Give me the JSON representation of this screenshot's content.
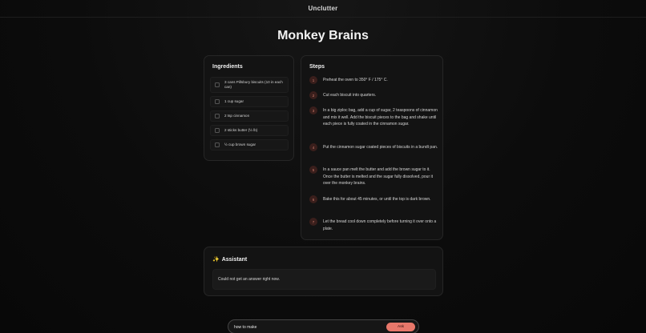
{
  "app": {
    "title": "Unclutter"
  },
  "recipe": {
    "title": "Monkey Brains"
  },
  "ingredients": {
    "title": "Ingredients",
    "items": [
      {
        "label": "3 cans Pillsbury biscuits (10 in each can)",
        "checked": false
      },
      {
        "label": "1 cup sugar",
        "checked": false
      },
      {
        "label": "2 tsp cinnamon",
        "checked": false
      },
      {
        "label": "2 sticks butter (½ lb)",
        "checked": false
      },
      {
        "label": "½ cup brown sugar",
        "checked": false
      }
    ]
  },
  "steps": {
    "title": "Steps",
    "items": [
      {
        "number": "1",
        "text": "Preheat the oven to 350° F / 175° C."
      },
      {
        "number": "2",
        "text": "Cut each biscuit into quarters."
      },
      {
        "number": "3",
        "text": "In a big ziploc bag, add a cup of sugar, 2 teaspoons of cinnamon and mix it well. Add the biscuit pieces to the bag and shake until each piece is fully coated in the cinnamon sugar."
      },
      {
        "number": "4",
        "text": "Put the cinnamon sugar coated pieces of biscuits in a bundt pan."
      },
      {
        "number": "5",
        "text": "In a sauce pan melt the butter and add the brown sugar to it. Once the butter is melted and the sugar fully dissolved, pour it over the monkey brains."
      },
      {
        "number": "6",
        "text": "Bake this for about 45 minutes, or until the top is dark brown."
      },
      {
        "number": "7",
        "text": "Let the bread cool down completely before turning it over onto a plate."
      }
    ]
  },
  "assistant": {
    "icon": "sparkle-icon",
    "title": "Assistant",
    "answer": "Could not get an answer right now."
  },
  "ask": {
    "input_value": "how to make",
    "button_label": "Ask"
  },
  "colors": {
    "accent": "#e8776a",
    "step_badge_bg": "#3a1f1c",
    "step_badge_fg": "#d07d6e",
    "background": "#0c0c0c"
  }
}
